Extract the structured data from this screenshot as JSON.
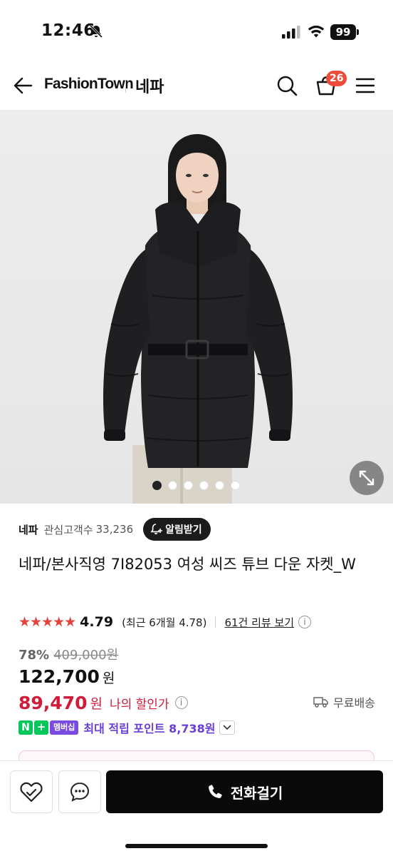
{
  "status": {
    "time": "12:46",
    "battery": "99"
  },
  "header": {
    "brand": "FashionTown",
    "sub": "네파",
    "cart_count": "26"
  },
  "gallery": {
    "count": 6,
    "active": 0
  },
  "product": {
    "brand": "네파",
    "fav_label": "관심고객수",
    "fav_count": "33,236",
    "alert_label": "알림받기",
    "title": "네파/본사직영 7I82053 여성 씨즈 튜브 다운 자켓_W",
    "stars": "★★★★★",
    "rating": "4.79",
    "rating_value": 4.79,
    "recent_rating": "(최근 6개월 4.78)",
    "review_link": "61건 리뷰 보기",
    "discount_rate": "78%",
    "original_price": "409,000원",
    "price": "122,700",
    "price_unit": "원",
    "my_price": "89,470",
    "my_price_unit": "원",
    "my_price_label": "나의 할인가",
    "shipping": "무료배송",
    "n_badge": "N",
    "plus_badge": "+",
    "member_badge": "멤버십",
    "points_text": "최대 적립 포인트 8,738원"
  },
  "bottom": {
    "call_label": "전화걸기"
  },
  "colors": {
    "accent_red": "#d11b3a",
    "star_red": "#e8413b",
    "points_purple": "#6a3ed8",
    "naver_green": "#03c75a"
  }
}
